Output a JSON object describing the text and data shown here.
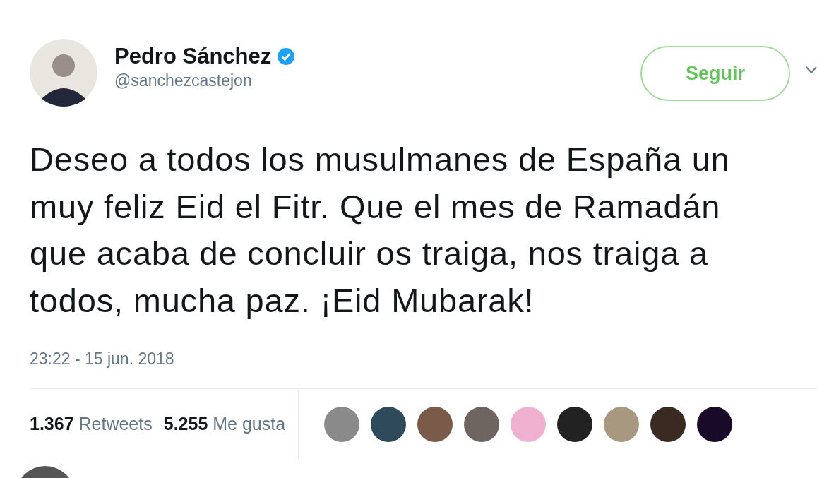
{
  "author": {
    "name": "Pedro Sánchez",
    "verified": true,
    "handle": "@sanchezcastejon"
  },
  "follow_button": {
    "label": "Seguir"
  },
  "tweet": {
    "text": "Deseo a todos los musulmanes de España un muy feliz Eid el Fitr. Que el mes de Ramadán que acaba de concluir os traiga, nos traiga a todos, mucha paz. ¡Eid Mubarak!",
    "timestamp": "23:22 - 15 jun. 2018"
  },
  "stats": [
    {
      "count": "1.367",
      "label": "Retweets"
    },
    {
      "count": "5.255",
      "label": "Me gusta"
    }
  ],
  "likers": [
    {
      "color": "#8a8a8a"
    },
    {
      "color": "#2f4a5a"
    },
    {
      "color": "#7a5a48"
    },
    {
      "color": "#6e6560"
    },
    {
      "color": "#f0b0d0"
    },
    {
      "color": "#222222"
    },
    {
      "color": "#a89880"
    },
    {
      "color": "#3a2a22"
    },
    {
      "color": "#1a0a2a"
    }
  ]
}
